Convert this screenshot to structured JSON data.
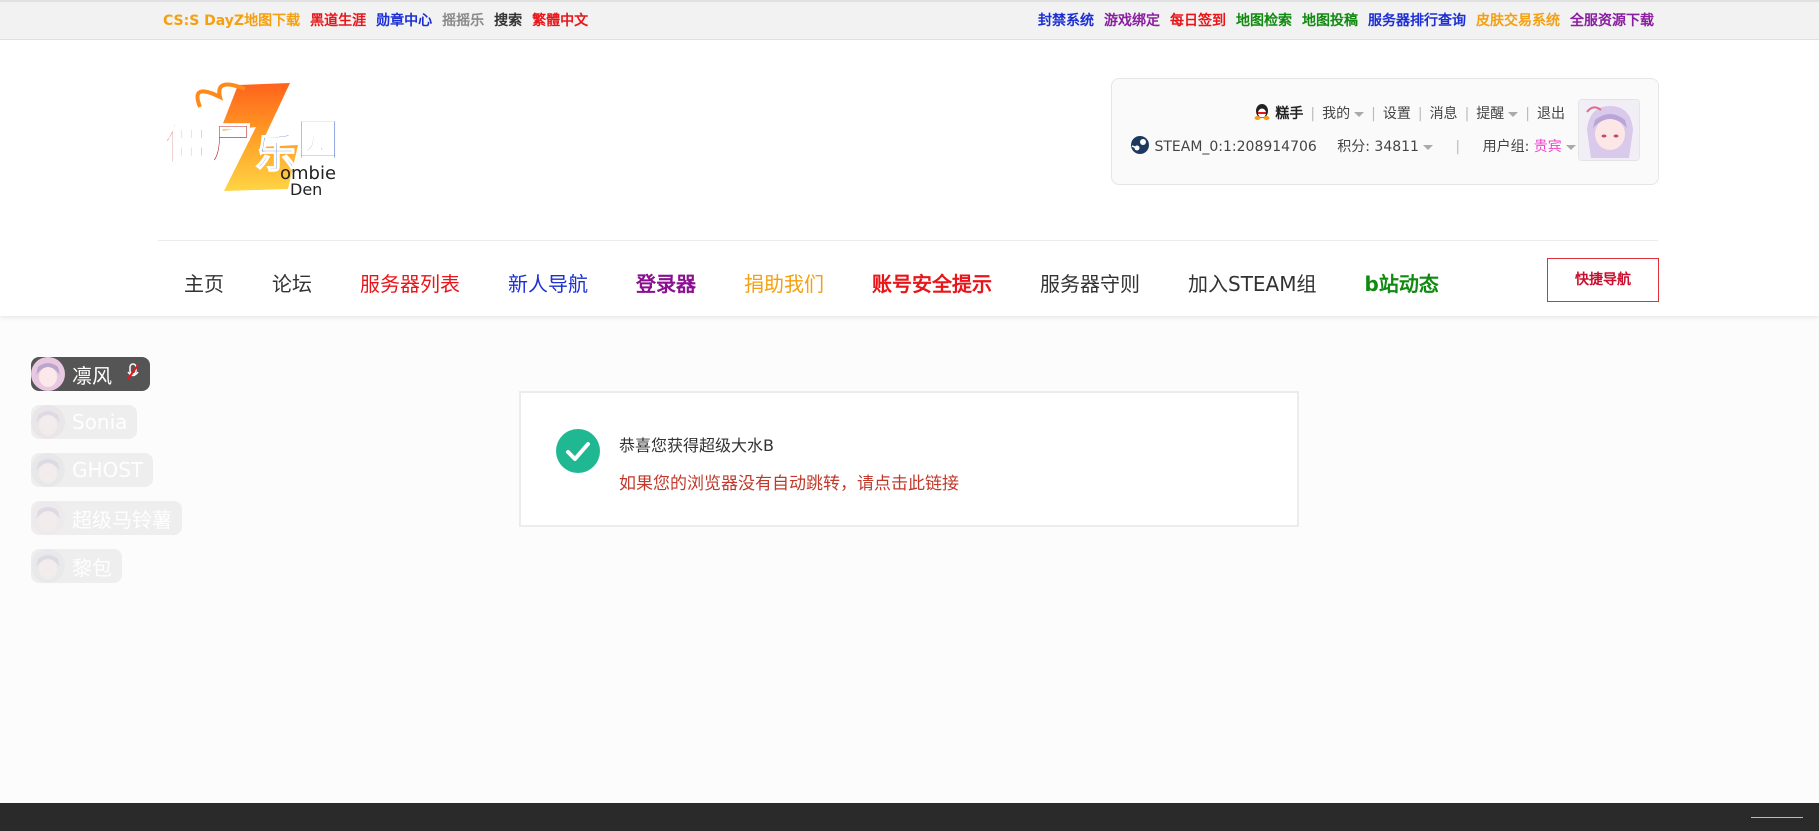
{
  "topbar": {
    "left_links": [
      {
        "label": "CS:S DayZ地图下载",
        "color": "#f5a010"
      },
      {
        "label": "黑道生涯",
        "color": "#e8161a"
      },
      {
        "label": "勋章中心",
        "color": "#1c2fd4"
      },
      {
        "label": "摇摇乐",
        "color": "#8a8a8a"
      },
      {
        "label": "搜索",
        "color": "#333333"
      },
      {
        "label": "繁體中文",
        "color": "#e8161a"
      }
    ],
    "right_links": [
      {
        "label": "封禁系统",
        "color": "#1c2fd4"
      },
      {
        "label": "游戏绑定",
        "color": "#8a1ea0"
      },
      {
        "label": "每日签到",
        "color": "#e8161a"
      },
      {
        "label": "地图检索",
        "color": "#118a11"
      },
      {
        "label": "地图投稿",
        "color": "#118a11"
      },
      {
        "label": "服务器排行查询",
        "color": "#1c2fd4"
      },
      {
        "label": "皮肤交易系统",
        "color": "#f5a010"
      },
      {
        "label": "全服资源下载",
        "color": "#8a1ea0"
      }
    ]
  },
  "logo": {
    "text_main": "僵尸乐园",
    "text_sub": "Zombie Den"
  },
  "user": {
    "name": "糕手",
    "menu": [
      "我的",
      "设置",
      "消息",
      "提醒",
      "退出"
    ],
    "steam_id": "STEAM_0:1:208914706",
    "points_label": "积分: 34811",
    "group_label": "用户组: ",
    "group_value": "贵宾",
    "group_color": "#ee44cc"
  },
  "nav": {
    "items": [
      {
        "label": "主页",
        "color": "#333333",
        "bold": false
      },
      {
        "label": "论坛",
        "color": "#333333",
        "bold": false
      },
      {
        "label": "服务器列表",
        "color": "#e8161a",
        "bold": false
      },
      {
        "label": "新人导航",
        "color": "#1c2fd4",
        "bold": false
      },
      {
        "label": "登录器",
        "color": "#8a1090",
        "bold": true
      },
      {
        "label": "捐助我们",
        "color": "#f5a010",
        "bold": false
      },
      {
        "label": "账号安全提示",
        "color": "#e8161a",
        "bold": true
      },
      {
        "label": "服务器守则",
        "color": "#333333",
        "bold": false
      },
      {
        "label": "加入STEAM组",
        "color": "#333333",
        "bold": false
      },
      {
        "label": "b站动态",
        "color": "#118a11",
        "bold": true
      }
    ],
    "quick_nav": "快捷导航"
  },
  "voice_users": [
    {
      "name": "凛风",
      "active": true
    },
    {
      "name": "Sonia",
      "active": false
    },
    {
      "name": "GHOST",
      "active": false
    },
    {
      "name": "超级马铃薯",
      "active": false
    },
    {
      "name": "黎包",
      "active": false
    }
  ],
  "message": {
    "title": "恭喜您获得超级大水B",
    "link": "如果您的浏览器没有自动跳转，请点击此链接"
  },
  "colors": {
    "accent_green": "#1fb893",
    "link_red": "#c0392b"
  },
  "icons": [
    "qq-icon",
    "steam-icon",
    "check-icon",
    "mic-off-icon",
    "caret-down-icon"
  ]
}
